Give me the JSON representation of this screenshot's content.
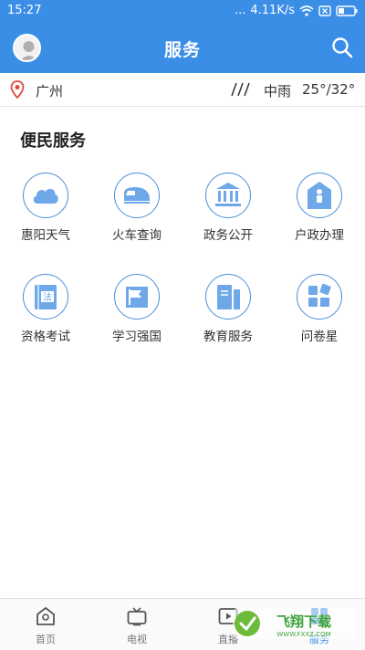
{
  "status_bar": {
    "time": "15:27",
    "dots": "...",
    "net_speed": "4.11K/s"
  },
  "header": {
    "title": "服务",
    "avatar_icon": "user-avatar-icon",
    "search_icon": "search-icon"
  },
  "location": {
    "city": "广州",
    "weather": "中雨",
    "temperature": "25°/32°"
  },
  "section": {
    "title": "便民服务"
  },
  "services": [
    {
      "label": "惠阳天气",
      "icon": "cloud-icon"
    },
    {
      "label": "火车查询",
      "icon": "train-icon"
    },
    {
      "label": "政务公开",
      "icon": "government-building-icon"
    },
    {
      "label": "户政办理",
      "icon": "household-registration-icon"
    },
    {
      "label": "资格考试",
      "icon": "law-book-icon"
    },
    {
      "label": "学习强国",
      "icon": "study-flag-icon"
    },
    {
      "label": "教育服务",
      "icon": "education-books-icon"
    },
    {
      "label": "问卷星",
      "icon": "questionnaire-icon"
    }
  ],
  "tabs": [
    {
      "label": "首页",
      "icon": "home-icon",
      "active": false
    },
    {
      "label": "电视",
      "icon": "tv-icon",
      "active": false
    },
    {
      "label": "直播",
      "icon": "live-play-icon",
      "active": false
    },
    {
      "label": "服务",
      "icon": "service-icon",
      "active": true
    }
  ],
  "watermark": {
    "text": "飞翔下载",
    "url_text": "WWW.FXXZ.COM"
  },
  "colors": {
    "brand": "#3a8ee6",
    "icon_stroke": "#4a8fd8",
    "icon_fill": "#6fa8e8"
  }
}
